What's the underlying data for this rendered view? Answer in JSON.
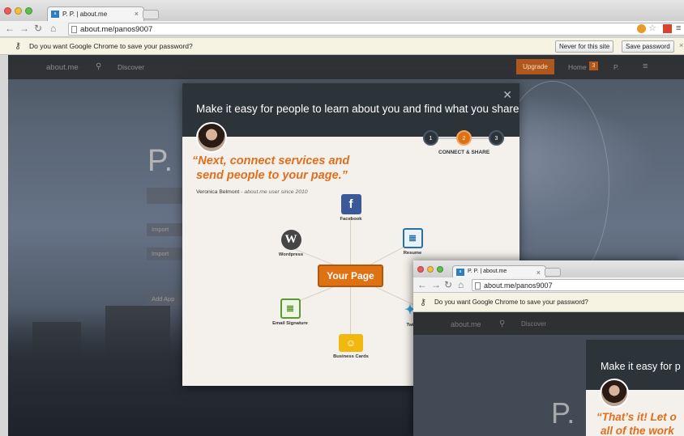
{
  "window1": {
    "tab_title": "P. P. | about.me",
    "tab_favicon": "about.me-icon",
    "url": "about.me/panos9007",
    "url_host": "about.me",
    "url_path": "/panos9007",
    "password_prompt": "Do you want Google Chrome to save your password?",
    "btn_never": "Never for this site",
    "btn_save": "Save password",
    "site_nav": {
      "logo": "about.me",
      "discover": "Discover",
      "upgrade": "Upgrade",
      "home": "Home",
      "home_badge": "3",
      "user_menu": "P."
    },
    "profile_initial": "P.",
    "side_items": [
      "Import",
      "Import",
      "Add App"
    ],
    "modal": {
      "title": "Make it easy for people to learn about you and find what you share",
      "steps": [
        "1",
        "2",
        "3"
      ],
      "active_step_label": "CONNECT & SHARE",
      "quote_line1": "“Next, connect services and",
      "quote_line2": "send people to your page.”",
      "byline_name": "Veronica Belmont",
      "byline_role": " - about.me user since 2010",
      "center_label": "Your Page",
      "services": {
        "facebook": "Facebook",
        "wordpress": "Wordpress",
        "resume": "Resume",
        "email_signature": "Email Signature",
        "business_cards": "Business Cards",
        "twitter": "Twi"
      }
    }
  },
  "window2": {
    "tab_title": "P. P. | about.me",
    "url": "about.me/panos9007",
    "password_prompt": "Do you want Google Chrome to save your password?",
    "site_nav": {
      "logo": "about.me",
      "discover": "Discover"
    },
    "profile_initial": "P.",
    "modal": {
      "title": "Make it easy for p",
      "quote_line1": "“That’s it! Let o",
      "quote_line2": "all of the work"
    }
  },
  "colors": {
    "accent_orange": "#de7213",
    "quote_orange": "#e06f1b",
    "modal_header": "#2c3339",
    "facebook_blue": "#3b5998"
  }
}
